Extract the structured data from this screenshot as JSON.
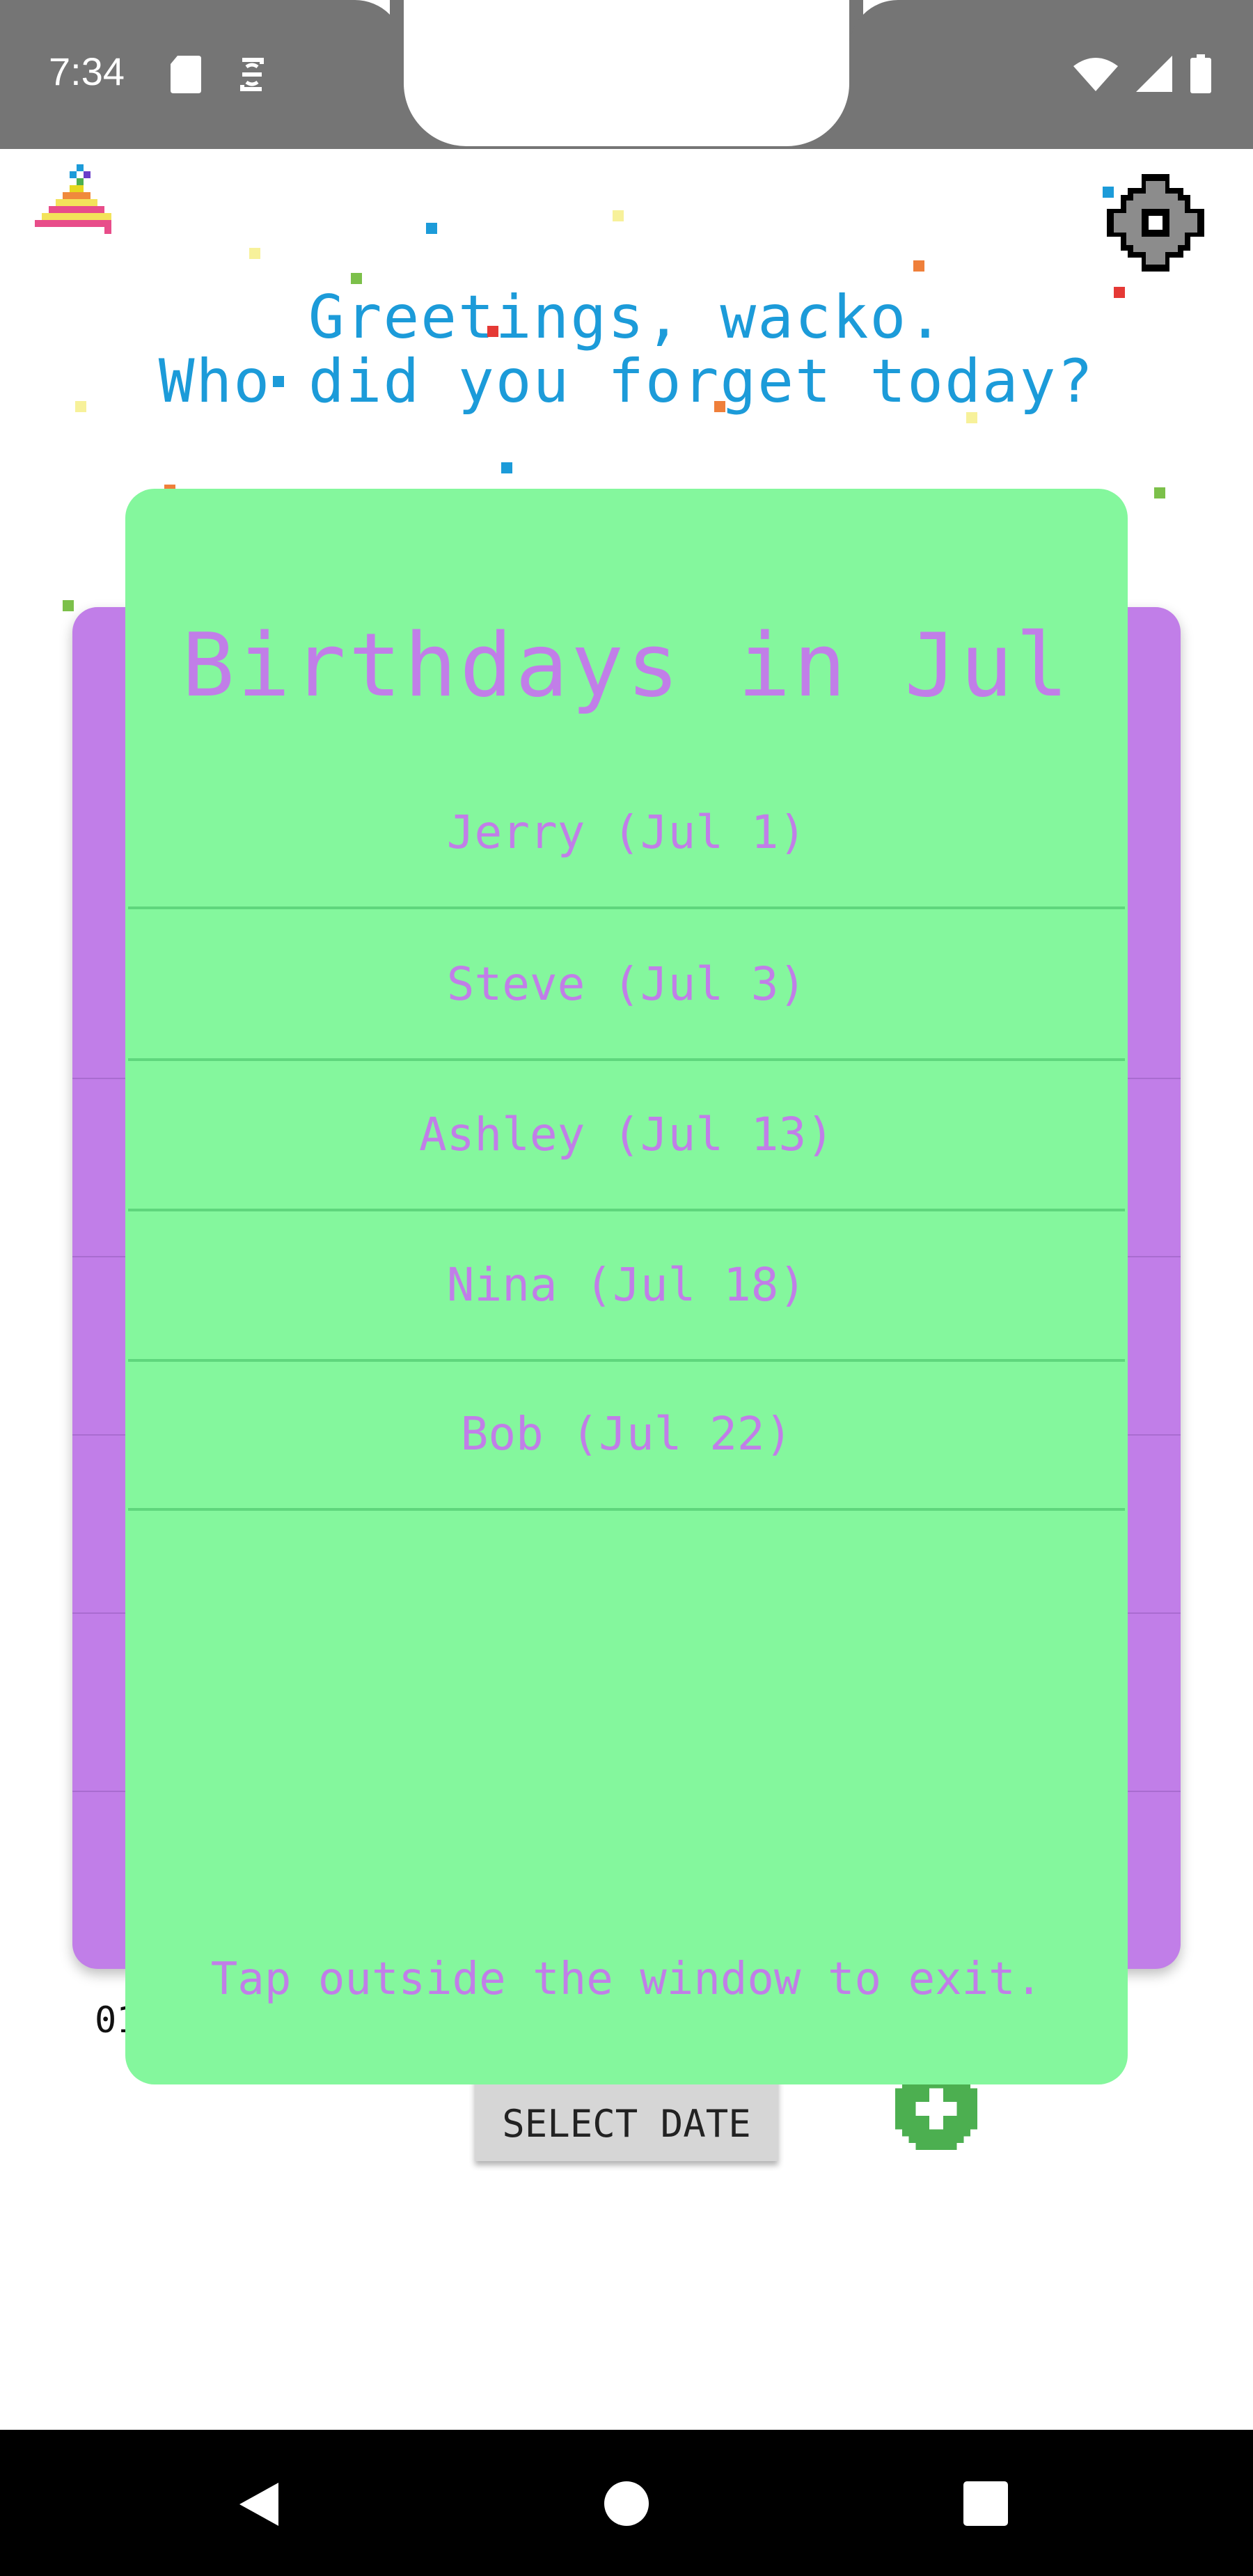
{
  "status_bar": {
    "time": "7:34",
    "icons": [
      "sd-card-icon",
      "sync-icon",
      "wifi-icon",
      "signal-icon",
      "battery-icon"
    ]
  },
  "header": {
    "greeting_line1": "Greetings, wacko.",
    "greeting_line2": "Who did you forget today?",
    "settings_icon": "gear-icon",
    "app_icon": "party-hat-icon"
  },
  "main": {
    "bottom_text": "01",
    "select_date_label": "SELECT DATE",
    "add_icon": "plus-icon"
  },
  "dialog": {
    "title": "Birthdays in Jul",
    "items": [
      "Jerry (Jul 1)",
      "Steve (Jul 3)",
      "Ashley (Jul 13)",
      "Nina (Jul 18)",
      "Bob (Jul 22)"
    ],
    "hint": "Tap outside the window to exit."
  },
  "colors": {
    "accent_purple": "#c17ee8",
    "dialog_green": "#84f79d",
    "greeting_blue": "#1c9bd9",
    "add_green": "#4caf50"
  },
  "nav_bar": {
    "icons": [
      "back-icon",
      "home-icon",
      "recents-icon"
    ]
  }
}
